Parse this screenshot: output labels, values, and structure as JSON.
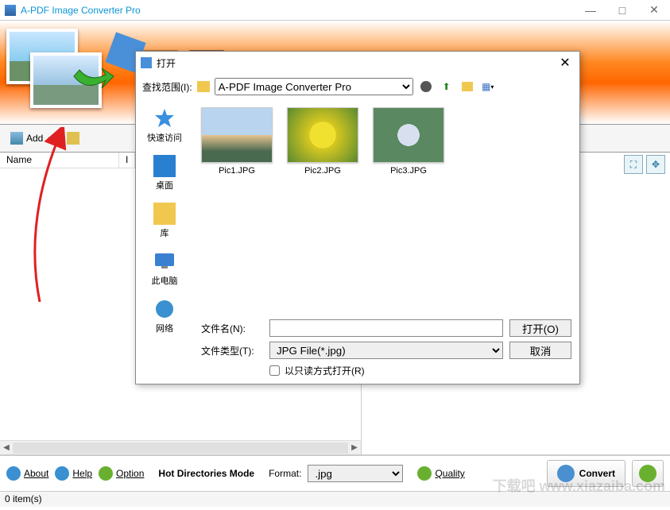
{
  "window": {
    "title": "A-PDF Image Converter Pro",
    "banner_title": "A-PDF Image Converter Pro"
  },
  "toolbar": {
    "add_label": "Add"
  },
  "columns": {
    "name": "Name",
    "imagesize": "Image Size"
  },
  "bottom": {
    "about": "About",
    "help": "Help",
    "option": "Option",
    "mode": "Hot Directories Mode",
    "format_label": "Format:",
    "format_value": ".jpg",
    "quality": "Quality",
    "convert": "Convert"
  },
  "status": {
    "items": "0 item(s)"
  },
  "dialog": {
    "title": "打开",
    "lookin_label": "查找范围(I):",
    "lookin_value": "A-PDF Image Converter Pro",
    "sidebar": {
      "quick": "快速访问",
      "desktop": "桌面",
      "library": "库",
      "thispc": "此电脑",
      "network": "网络"
    },
    "files": [
      {
        "name": "Pic1.JPG"
      },
      {
        "name": "Pic2.JPG"
      },
      {
        "name": "Pic3.JPG"
      }
    ],
    "filename_label": "文件名(N):",
    "filename_value": "",
    "filetype_label": "文件类型(T):",
    "filetype_value": "JPG File(*.jpg)",
    "open_btn": "打开(O)",
    "cancel_btn": "取消",
    "readonly": "以只读方式打开(R)"
  }
}
